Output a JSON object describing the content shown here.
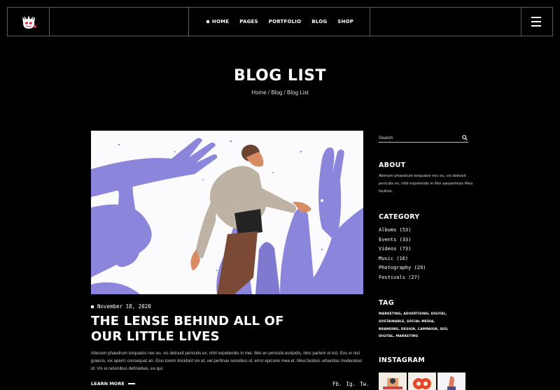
{
  "header": {
    "nav": [
      {
        "label": "HOME",
        "active": true
      },
      {
        "label": "PAGES"
      },
      {
        "label": "PORTFOLIO"
      },
      {
        "label": "BLOG"
      },
      {
        "label": "SHOP"
      }
    ]
  },
  "hero": {
    "title": "BLOG LIST",
    "breadcrumb": [
      "Home",
      "Blog",
      "Blog List"
    ],
    "separator": " / "
  },
  "post": {
    "date": "November 18, 2020",
    "title": "THE LENSE BEHIND ALL OF OUR LITTLE LIVES",
    "excerpt": "Alienum phaedrum torquatos nec eu, vis detraxit periculis ex, nihil expetendis in mei. Mei an pericula euripidis, hinc partem ei est. Eos ei nisl graecis, vix aperiri consequat an. Eius lorem tincidunt vix at, vel pertinax sensibus id, error epicurei mea et. Mea facilisis urbanitas moderatius id. Vis ei rationibus definiebas, eu qui.",
    "read_more": "LEARN MORE",
    "share": [
      "Fb.",
      "Ig.",
      "Tw."
    ]
  },
  "sidebar": {
    "search_placeholder": "Search",
    "about": {
      "title": "ABOUT",
      "text": "Alienum phaedrum torquatos nec eu, vis detraxit periculis ex, nihil expetendis in Mei aanpertinax Mea facilisis."
    },
    "category": {
      "title": "CATEGORY",
      "items": [
        "Albums (53)",
        "Events  (33)",
        "Videos (73)",
        "Music (16)",
        "Photography (29)",
        "Festivals (27)"
      ]
    },
    "tag": {
      "title": "TAG",
      "items": [
        "MARKETING,",
        "ADVERTISING,",
        "DIGITAL,",
        "SUSTAINABLE,",
        "SOCIAL MEDIA,",
        "BRANDING,",
        "DESIGN,",
        "CAMPAIGN,",
        "SEO,",
        "DIGITAL,",
        "MARKETING"
      ]
    },
    "instagram": {
      "title": "INSTAGRAM"
    }
  },
  "colors": {
    "background": "#000000",
    "border": "#5a5a5a",
    "illustration_purple": "#8b86db",
    "illustration_bg": "#fbfbfd"
  },
  "icons": [
    "logo-icon",
    "menu-icon",
    "search-icon"
  ]
}
